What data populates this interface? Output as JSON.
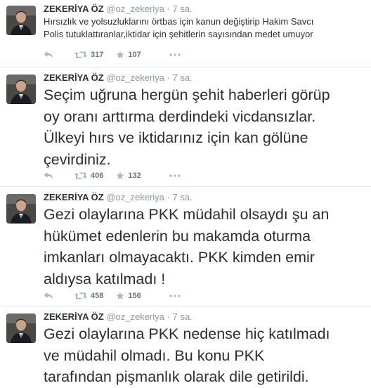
{
  "tweets": [
    {
      "name": "ZEKERİYA ÖZ",
      "handle": "@oz_zekeriya",
      "dot": "·",
      "time": "7 sa.",
      "text_lines": [
        "Hırsızlık ve yolsuzluklarını örtbas için kanun değiştirip Hakim Savcı",
        "Polis tutuklattıranlar,iktidar için şehitlerin sayısından medet umuyor"
      ],
      "retweets": "317",
      "favorites": "107"
    },
    {
      "name": "ZEKERİYA ÖZ",
      "handle": "@oz_zekeriya",
      "dot": "·",
      "time": "7 sa.",
      "text_lines": [
        "Seçim uğruna hergün şehit haberleri görüp",
        "oy oranı arttırma derdindeki vicdansızlar.",
        "Ülkeyi hırs ve iktidarınız için kan gölüne",
        "çevirdiniz."
      ],
      "retweets": "406",
      "favorites": "132"
    },
    {
      "name": "ZEKERİYA ÖZ",
      "handle": "@oz_zekeriya",
      "dot": "·",
      "time": "7 sa.",
      "text_lines": [
        "Gezi olaylarına PKK müdahil olsaydı şu an",
        "hükümet edenlerin bu makamda oturma",
        "imkanları olmayacaktı. PKK kimden emir",
        "aldıysa katılmadı !"
      ],
      "retweets": "458",
      "favorites": "156"
    },
    {
      "name": "ZEKERİYA ÖZ",
      "handle": "@oz_zekeriya",
      "dot": "·",
      "time": "7 sa.",
      "text_lines": [
        "Gezi olaylarına PKK nedense hiç katılmadı",
        "ve müdahil olmadı. Bu konu PKK",
        "tarafından pişmanlık olarak dile getirildi."
      ],
      "retweets": "",
      "favorites": ""
    }
  ],
  "colors": {
    "text": "#292f33",
    "muted": "#8899a6",
    "icon": "#aab8c2",
    "count": "#66757f",
    "divider": "#e1e8ed"
  },
  "icons": [
    "avatar",
    "reply-icon",
    "retweet-icon",
    "favorite-icon",
    "more-icon"
  ]
}
